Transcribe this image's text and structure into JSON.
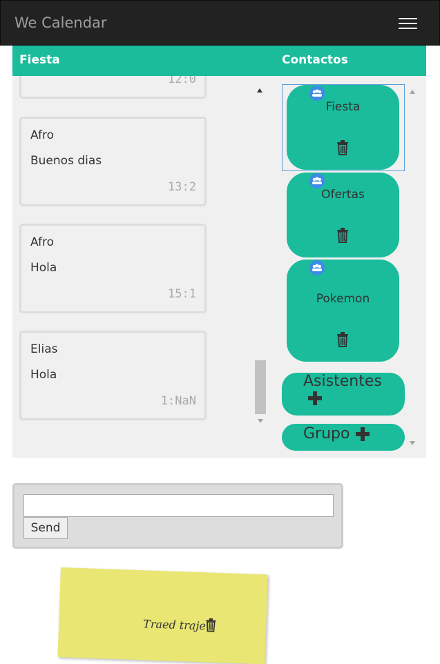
{
  "navbar": {
    "brand": "We Calendar",
    "menu_icon": "hamburger-icon"
  },
  "headers": {
    "chat_title": "Fiesta",
    "contacts_title": "Contactos"
  },
  "messages": [
    {
      "sender": "Afro",
      "text": "Buenos dias",
      "time": "13:2"
    },
    {
      "sender": "Afro",
      "text": "Hola",
      "time": "15:1"
    },
    {
      "sender": "Elias",
      "text": "Hola",
      "time": "1:NaN"
    }
  ],
  "contacts": [
    {
      "name": "Fiesta",
      "icon": "group-icon",
      "action_icon": "trash-icon",
      "selected": true
    },
    {
      "name": "Ofertas",
      "icon": "group-icon",
      "action_icon": "trash-icon",
      "selected": false
    },
    {
      "name": "Pokemon",
      "icon": "group-icon",
      "action_icon": "trash-icon",
      "selected": false
    }
  ],
  "buttons": {
    "asistentes": "Asistentes",
    "grupo": "Grupo",
    "send": "Send"
  },
  "composer": {
    "input_value": ""
  },
  "note": {
    "text": "Traed traje",
    "action_icon": "trash-icon"
  },
  "colors": {
    "navbar": "#222222",
    "accent": "#1abc9c",
    "group_icon": "#3d8be8",
    "note": "#e9e673",
    "panel": "#f0f0f0"
  }
}
